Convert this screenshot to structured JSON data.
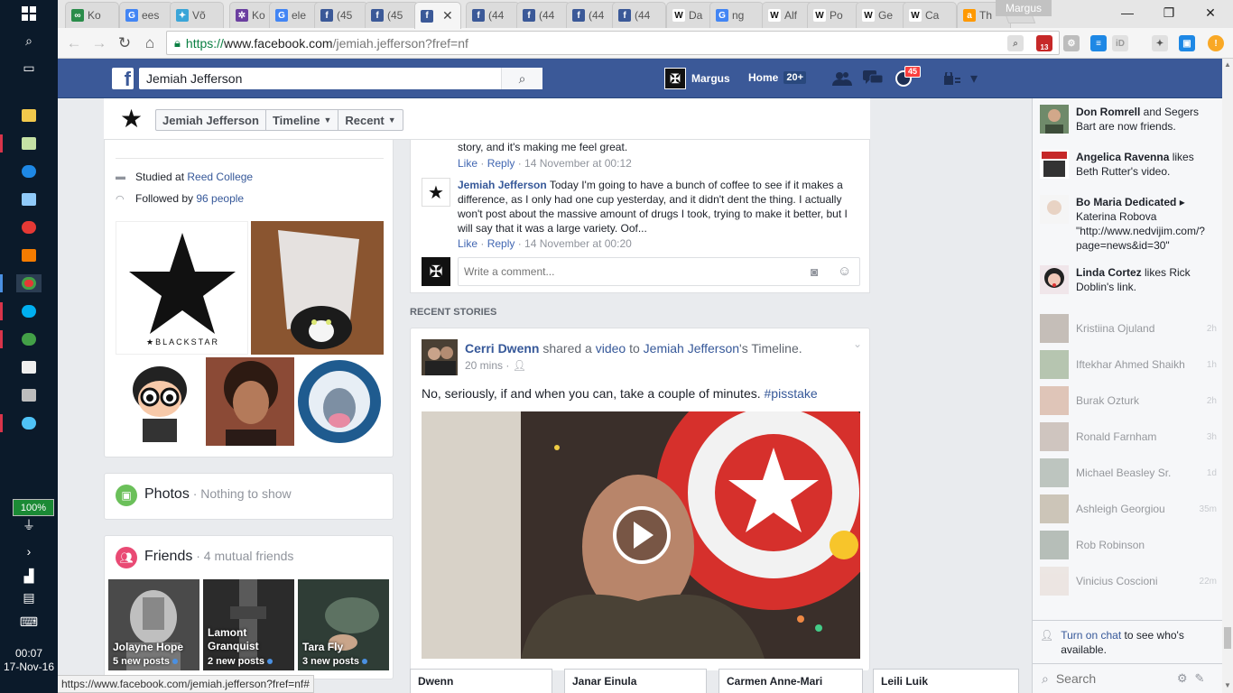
{
  "taskbar": {
    "battery": "100%",
    "time": "00:07",
    "date": "17-Nov-16"
  },
  "browser": {
    "tabs": [
      {
        "label": "Ko",
        "color": "#2a8c4a",
        "glyph": "∞"
      },
      {
        "label": "ees",
        "color": "#4285f4",
        "glyph": "G"
      },
      {
        "label": "Võ",
        "color": "#3aa5d8",
        "glyph": "✦"
      },
      {
        "label": "Ko",
        "color": "#6b3fa0",
        "glyph": "✲"
      },
      {
        "label": "ele",
        "color": "#4285f4",
        "glyph": "G"
      },
      {
        "label": "(45",
        "color": "#3b5998",
        "glyph": "f"
      },
      {
        "label": "(45",
        "color": "#3b5998",
        "glyph": "f"
      },
      {
        "label": "",
        "color": "#3b5998",
        "glyph": "f"
      },
      {
        "label": "(44",
        "color": "#3b5998",
        "glyph": "f"
      },
      {
        "label": "(44",
        "color": "#3b5998",
        "glyph": "f"
      },
      {
        "label": "(44",
        "color": "#3b5998",
        "glyph": "f"
      },
      {
        "label": "(44",
        "color": "#3b5998",
        "glyph": "f"
      },
      {
        "label": "Da",
        "color": "#ffffff",
        "glyph": "W"
      },
      {
        "label": "ng",
        "color": "#4285f4",
        "glyph": "G"
      },
      {
        "label": "Alf",
        "color": "#ffffff",
        "glyph": "W"
      },
      {
        "label": "Po",
        "color": "#ffffff",
        "glyph": "W"
      },
      {
        "label": "Ge",
        "color": "#ffffff",
        "glyph": "W"
      },
      {
        "label": "Ca",
        "color": "#ffffff",
        "glyph": "W"
      },
      {
        "label": "Th",
        "color": "#ff9900",
        "glyph": "a"
      }
    ],
    "profile_chip": "Margus",
    "url_scheme": "https://",
    "url_host": "www.facebook.com",
    "url_path": "/jemiah.jefferson?fref=nf",
    "extension_badge": "13",
    "status_url": "https://www.facebook.com/jemiah.jefferson?fref=nf#"
  },
  "fb": {
    "search_value": "Jemiah Jefferson",
    "user_name": "Margus",
    "home_label": "Home",
    "home_count": "20+",
    "notif_count": "45"
  },
  "timeline_nav": {
    "name": "Jemiah Jefferson",
    "timeline": "Timeline",
    "recent": "Recent"
  },
  "intro": {
    "studied_prefix": "Studied at",
    "studied_link": "Reed College",
    "followed_prefix": "Followed by",
    "followed_link": "96 people",
    "star_caption": "★BLACKSTAR"
  },
  "photos": {
    "title": "Photos",
    "sub": " · Nothing to show"
  },
  "friends": {
    "title": "Friends",
    "sub": " · 4 mutual friends",
    "tiles": [
      {
        "name": "Jolayne Hope",
        "posts": "5 new posts"
      },
      {
        "name": "Lamont Granquist",
        "posts": "2 new posts"
      },
      {
        "name": "Tara Fly",
        "posts": "3 new posts"
      }
    ]
  },
  "comments": {
    "prev_text": "story, and it's making me feel great.",
    "prev_like": "Like",
    "prev_reply": "Reply",
    "prev_time": "14 November at 00:12",
    "author": "Jemiah Jefferson",
    "body": "Today I'm going to have a bunch of coffee to see if it makes a difference, as I only had one cup yesterday, and it didn't dent the thing. I actually won't post about the massive amount of drugs I took, trying to make it better, but I will say that it was a large variety. Oof...",
    "like": "Like",
    "reply": "Reply",
    "time": "14 November at 00:20",
    "write_placeholder": "Write a comment..."
  },
  "recent_label": "RECENT STORIES",
  "story": {
    "author": "Cerri Dwenn",
    "shared": "shared a",
    "video": "video",
    "to": "to",
    "target": "Jemiah Jefferson",
    "suffix": "'s Timeline.",
    "time": "20 mins",
    "text": "No, seriously, if and when you can, take a couple of minutes.",
    "hashtag": "#pisstake"
  },
  "chat_tabs": [
    "Dwenn",
    "Janar Einula",
    "Carmen Anne-Mari",
    "Leili Luik"
  ],
  "ticker": [
    {
      "bold1": "Don Romrell",
      "rest": " and Segers Bart are now friends."
    },
    {
      "bold1": "Angelica Ravenna",
      "rest": " likes Beth Rutter's video."
    },
    {
      "bold1": "Bo Maria Dedicated",
      "rest": " ▸ Katerina Robova \"http://www.nedvijim.com/?page=news&id=30\""
    },
    {
      "bold1": "Linda Cortez",
      "rest": " likes Rick Doblin's link."
    }
  ],
  "chat_list": [
    {
      "name": "Kristiina Ojuland",
      "time": "2h"
    },
    {
      "name": "Iftekhar Ahmed Shaikh",
      "time": "1h"
    },
    {
      "name": "Burak Ozturk",
      "time": "2h"
    },
    {
      "name": "Ronald Farnham",
      "time": "3h"
    },
    {
      "name": "Michael Beasley Sr.",
      "time": "1d"
    },
    {
      "name": "Ashleigh Georgiou",
      "time": "35m"
    },
    {
      "name": "Rob Robinson",
      "time": ""
    },
    {
      "name": "Vinicius Coscioni",
      "time": "22m"
    }
  ],
  "turn_chat_link": "Turn on chat",
  "turn_chat_rest": " to see who's available.",
  "chat_search_placeholder": "Search"
}
